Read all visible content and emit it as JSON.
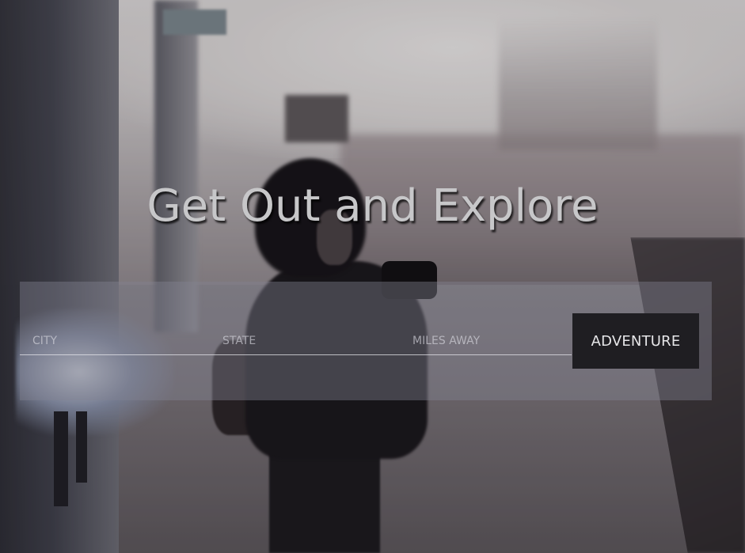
{
  "hero": {
    "headline": "Get Out and Explore"
  },
  "search": {
    "city_placeholder": "CITY",
    "state_placeholder": "STATE",
    "miles_placeholder": "MILES AWAY",
    "city_value": "",
    "state_value": "",
    "miles_value": "",
    "submit_label": "ADVENTURE"
  },
  "colors": {
    "headline": "#c7c7c9",
    "panel_overlay": "rgba(130,130,146,0.42)",
    "button_bg": "#1f1e22",
    "button_text": "#e6e6e8"
  }
}
